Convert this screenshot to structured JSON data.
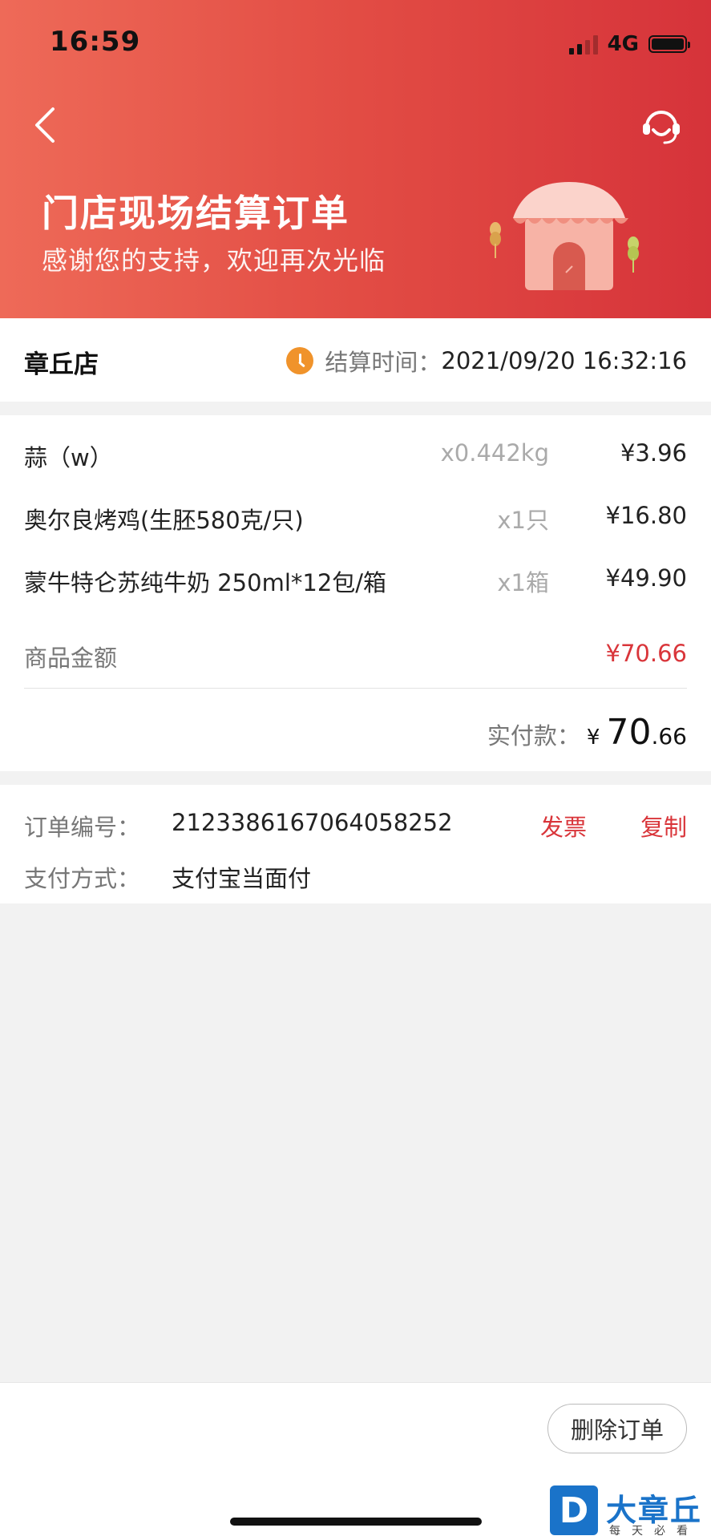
{
  "status_bar": {
    "time": "16:59",
    "network": "4G"
  },
  "header": {
    "title": "门店现场结算订单",
    "subtitle": "感谢您的支持，欢迎再次光临"
  },
  "store": {
    "name": "章丘店",
    "settle_label": "结算时间：",
    "settle_time": "2021/09/20 16:32:16"
  },
  "items": [
    {
      "name": "蒜（w）",
      "qty": "x0.442kg",
      "price": "¥3.96"
    },
    {
      "name": "奥尔良烤鸡(生胚580克/只)",
      "qty": "x1只",
      "price": "¥16.80"
    },
    {
      "name": "蒙牛特仑苏纯牛奶 250ml*12包/箱",
      "qty": "x1箱",
      "price": "¥49.90"
    }
  ],
  "summary": {
    "subtotal_label": "商品金额",
    "subtotal_value": "¥70.66",
    "paid_label": "实付款：",
    "paid_currency": "¥",
    "paid_integer": "70",
    "paid_decimal": ".66"
  },
  "order_info": {
    "number_label": "订单编号：",
    "number_value": "2123386167064058252",
    "invoice_link": "发票",
    "copy_link": "复制",
    "payment_label": "支付方式：",
    "payment_value": "支付宝当面付"
  },
  "actions": {
    "delete_label": "删除订单"
  },
  "watermark": {
    "logo_letter": "D",
    "name": "大章丘",
    "tagline": "每天必看"
  },
  "colors": {
    "header_start": "#ee6a58",
    "header_end": "#d6333a",
    "accent_red": "#d9353a",
    "clock_orange": "#f0932b"
  }
}
